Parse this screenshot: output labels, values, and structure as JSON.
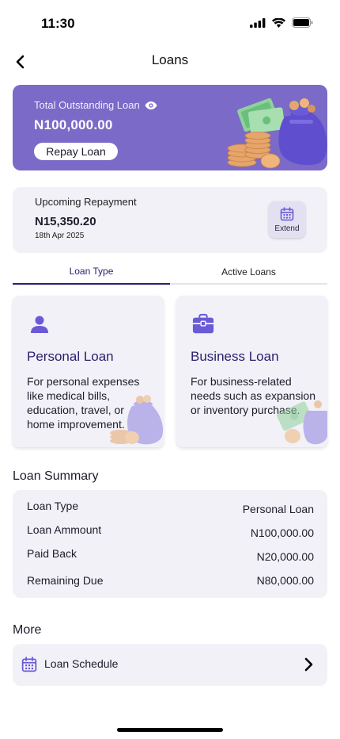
{
  "status_bar": {
    "time": "11:30",
    "icons": [
      "signal-icon",
      "wifi-icon",
      "battery-icon"
    ]
  },
  "nav": {
    "title": "Loans",
    "back_icon": "chevron-left-icon"
  },
  "balance": {
    "label": "Total Outstanding Loan",
    "amount": "N100,000.00",
    "repay_label": "Repay Loan",
    "eye_icon": "eye-icon",
    "color": "#7b6ac7"
  },
  "upcoming": {
    "label": "Upcoming Repayment",
    "amount": "N15,350.20",
    "date": "18th Apr 2025",
    "extend_label": "Extend"
  },
  "tabs": [
    {
      "label": "Loan Type",
      "active": true
    },
    {
      "label": "Active Loans",
      "active": false
    }
  ],
  "loan_types": [
    {
      "title": "Personal Loan",
      "description": "For personal expenses like medical bills, education, travel, or home improvement.",
      "icon": "person-icon"
    },
    {
      "title": "Business Loan",
      "description": "For business-related needs such as expansion or inventory purchase.",
      "icon": "briefcase-icon"
    }
  ],
  "summary": {
    "title": "Loan Summary",
    "rows": [
      {
        "key": "Loan Type",
        "value": "Personal Loan"
      },
      {
        "key": "Loan Ammount",
        "value": "N100,000.00"
      },
      {
        "key": "Paid Back",
        "value": "N20,000.00"
      },
      {
        "key": "Remaining Due",
        "value": "N80,000.00"
      }
    ]
  },
  "more": {
    "title": "More",
    "items": [
      {
        "label": "Loan Schedule",
        "icon": "calendar-icon"
      }
    ]
  },
  "colors": {
    "accent": "#2b2170",
    "card_bg": "#f1f1f7",
    "banner": "#7b6ac7"
  }
}
